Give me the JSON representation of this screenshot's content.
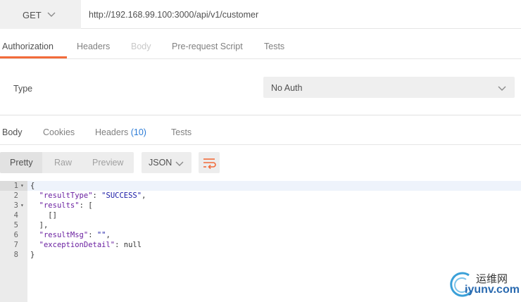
{
  "request": {
    "method": "GET",
    "url": "http://192.168.99.100:3000/api/v1/customer"
  },
  "request_tabs": [
    {
      "label": "Authorization",
      "state": "active"
    },
    {
      "label": "Headers",
      "state": "normal"
    },
    {
      "label": "Body",
      "state": "disabled"
    },
    {
      "label": "Pre-request Script",
      "state": "normal"
    },
    {
      "label": "Tests",
      "state": "normal"
    }
  ],
  "auth": {
    "type_label": "Type",
    "selected": "No Auth"
  },
  "response_tabs": [
    {
      "label": "Body",
      "state": "active"
    },
    {
      "label": "Cookies",
      "state": "normal"
    },
    {
      "label": "Headers",
      "count": "(10)",
      "state": "normal"
    },
    {
      "label": "Tests",
      "state": "normal"
    }
  ],
  "toolbar": {
    "views": [
      "Pretty",
      "Raw",
      "Preview"
    ],
    "active_view": "Pretty",
    "format": "JSON",
    "wrap_icon": "wrap-lines-icon"
  },
  "code_lines": [
    {
      "n": "1",
      "fold": true,
      "text": "{"
    },
    {
      "n": "2",
      "fold": false,
      "text": "  \"resultType\": \"SUCCESS\","
    },
    {
      "n": "3",
      "fold": true,
      "text": "  \"results\": ["
    },
    {
      "n": "4",
      "fold": false,
      "text": "    []"
    },
    {
      "n": "5",
      "fold": false,
      "text": "  ],"
    },
    {
      "n": "6",
      "fold": false,
      "text": "  \"resultMsg\": \"\","
    },
    {
      "n": "7",
      "fold": false,
      "text": "  \"exceptionDetail\": null"
    },
    {
      "n": "8",
      "fold": false,
      "text": "}"
    }
  ],
  "watermark": {
    "cn": "运维网",
    "en": "iyunv.com"
  },
  "colors": {
    "accent": "#f26b3a",
    "link": "#2b7bd6",
    "json_key": "#6a1fa0",
    "json_string": "#1a1aa6"
  }
}
